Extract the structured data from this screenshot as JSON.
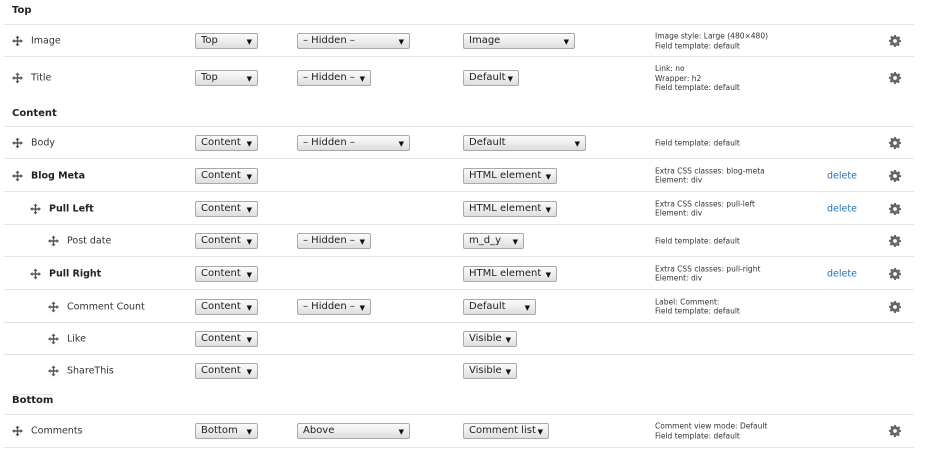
{
  "regions": {
    "top": "Top",
    "content": "Content",
    "bottom": "Bottom"
  },
  "rows": [
    {
      "label": "Image",
      "region": "Top",
      "label_display": "– Hidden –",
      "format": "Image",
      "summary": "Image style: Large (480×480)\nField template: default",
      "delete": ""
    },
    {
      "label": "Title",
      "region": "Top",
      "label_display": "– Hidden –",
      "format": "Default",
      "summary": "Link: no\nWrapper: h2\nField template: default",
      "delete": ""
    },
    {
      "label": "Body",
      "region": "Content",
      "label_display": "– Hidden –",
      "format": "Default",
      "summary": "Field template: default",
      "delete": ""
    },
    {
      "label": "Blog Meta",
      "region": "Content",
      "label_display": "",
      "format": "HTML element",
      "summary": "Extra CSS classes: blog-meta\nElement: div",
      "delete": "delete"
    },
    {
      "label": "Pull Left",
      "region": "Content",
      "label_display": "",
      "format": "HTML element",
      "summary": "Extra CSS classes: pull-left\nElement: div",
      "delete": "delete"
    },
    {
      "label": "Post date",
      "region": "Content",
      "label_display": "– Hidden –",
      "format": "m_d_y",
      "summary": "Field template: default",
      "delete": ""
    },
    {
      "label": "Pull Right",
      "region": "Content",
      "label_display": "",
      "format": "HTML element",
      "summary": "Extra CSS classes: pull-right\nElement: div",
      "delete": "delete"
    },
    {
      "label": "Comment Count",
      "region": "Content",
      "label_display": "– Hidden –",
      "format": "Default",
      "summary": "Label: Comment:\nField template: default",
      "delete": ""
    },
    {
      "label": "Like",
      "region": "Content",
      "label_display": "",
      "format": "Visible",
      "summary": "",
      "delete": ""
    },
    {
      "label": "ShareThis",
      "region": "Content",
      "label_display": "",
      "format": "Visible",
      "summary": "",
      "delete": ""
    },
    {
      "label": "Comments",
      "region": "Bottom",
      "label_display": "Above",
      "format": "Comment list",
      "summary": "Comment view mode: Default\nField template: default",
      "delete": ""
    }
  ],
  "icons": {
    "drag_handle": "move-arrows-icon",
    "settings": "gear-icon",
    "select_arrow": "dropdown-arrow-icon"
  },
  "colors": {
    "link": "#1d71b8",
    "row_border": "#e4e4e4"
  }
}
